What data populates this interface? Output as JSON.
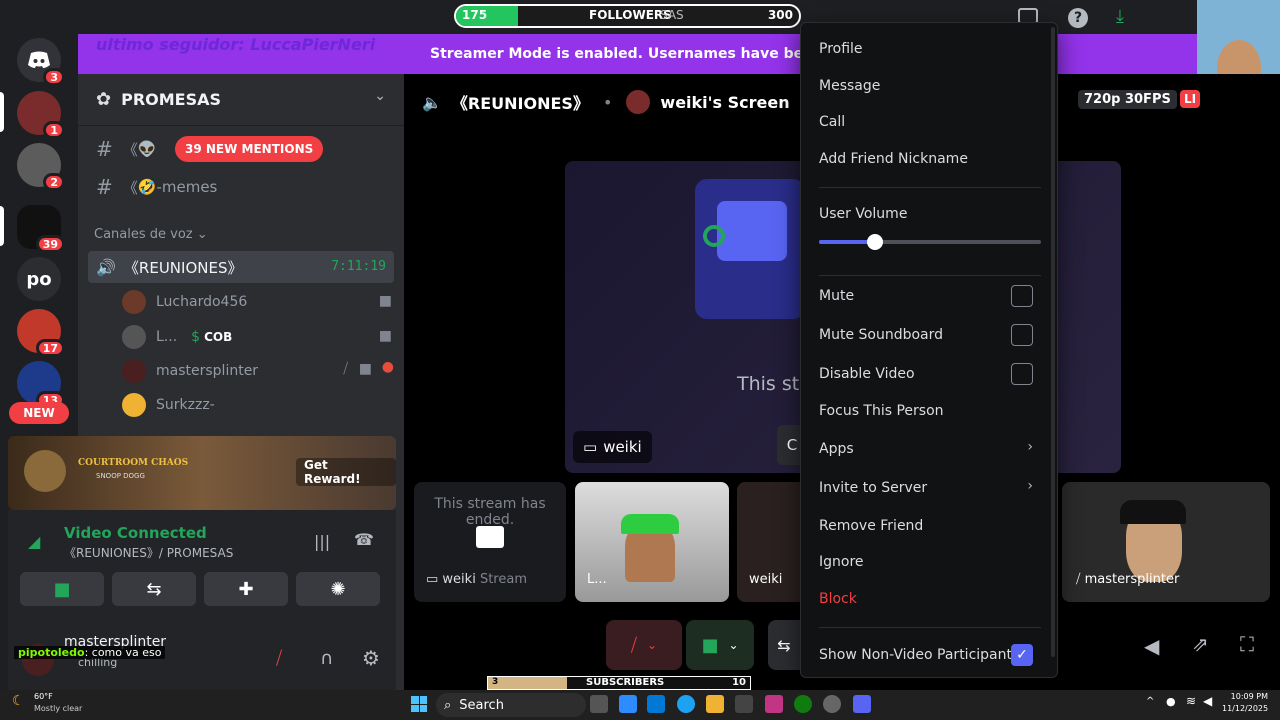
{
  "followers_bar": {
    "left": "175",
    "label": "FOLLOWERS",
    "overlay": "SAS",
    "right": "300",
    "progress": 0.18
  },
  "top_banner": {
    "overlay_text": "ultimo seguidor: LuccaPierNeri",
    "text": "Streamer Mode is enabled. Usernames have been truncat"
  },
  "servers": [
    {
      "badge": "3"
    },
    {
      "badge": "1"
    },
    {
      "badge": "2"
    },
    {
      "badge": "39"
    },
    {
      "label": "po"
    },
    {
      "badge": "17"
    },
    {
      "badge": "13"
    },
    {
      "badge": "NEW"
    }
  ],
  "sidebar": {
    "server_name": "PROMESAS",
    "channels": [
      {
        "prefix": "《",
        "name": "-memes",
        "emoji": "🤣"
      },
      {
        "prefix": "《",
        "name": "",
        "emoji": "👽"
      }
    ],
    "mentions_pill": "39 NEW MENTIONS",
    "voice_category": "Canales de voz",
    "voice_channel": {
      "name": "《REUNIONES》",
      "timer": "7:11:19"
    },
    "voice_users": [
      {
        "name": "Luchardo456"
      },
      {
        "name": "L...",
        "tag": "COB"
      },
      {
        "name": "mastersplinter"
      },
      {
        "name": "Surkzzz-"
      }
    ],
    "reward": {
      "title": "COURTROOM CHAOS",
      "subtitle": "SNOOP DOGG",
      "button": "Get Reward!"
    },
    "connection": {
      "status": "Video Connected",
      "channel": "《REUNIONES》/ PROMESAS"
    },
    "user": {
      "name": "mastersplinter",
      "status": "chilling"
    },
    "chat_overlay": {
      "user": "pipotoledo",
      "message": ": como va eso"
    }
  },
  "main_header": {
    "channel": "《REUNIONES》",
    "screen": "weiki's Screen",
    "quality": "720p 30FPS",
    "live": "LI"
  },
  "stream": {
    "ended_text": "This str",
    "owner": "weiki",
    "button_partial": "C"
  },
  "tiles": [
    {
      "ended": "This stream has ended.",
      "name": "weiki",
      "suffix": "Stream"
    },
    {
      "name": "L..."
    },
    {
      "name": "weiki"
    },
    {
      "name": "mastersplinter"
    }
  ],
  "subscribers_bar": {
    "left": "3",
    "label": "SUBSCRIBERS",
    "right": "10",
    "progress": 0.3
  },
  "menu": {
    "items": [
      "Profile",
      "Message",
      "Call",
      "Add Friend Nickname"
    ],
    "volume_label": "User Volume",
    "volume_level": 0.25,
    "checks": [
      "Mute",
      "Mute Soundboard",
      "Disable Video"
    ],
    "focus": "Focus This Person",
    "apps": "Apps",
    "invite": "Invite to Server",
    "remove": "Remove Friend",
    "ignore": "Ignore",
    "block": "Block",
    "show_nonvideo": "Show Non-Video Participants"
  },
  "taskbar": {
    "temp": "60°F",
    "weather": "Mostly clear",
    "search": "Search",
    "time": "10:09 PM",
    "date": "11/12/2025"
  },
  "colors": {
    "accent": "#5865f2",
    "danger": "#f23f43",
    "green": "#23a55a",
    "purple": "#9333ea"
  }
}
